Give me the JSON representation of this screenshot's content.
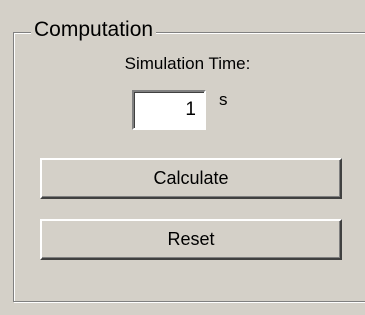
{
  "computation": {
    "title": "Computation",
    "simulation_time_label": "Simulation Time:",
    "simulation_time_value": "1",
    "time_unit": "s",
    "calculate_label": "Calculate",
    "reset_label": "Reset"
  }
}
